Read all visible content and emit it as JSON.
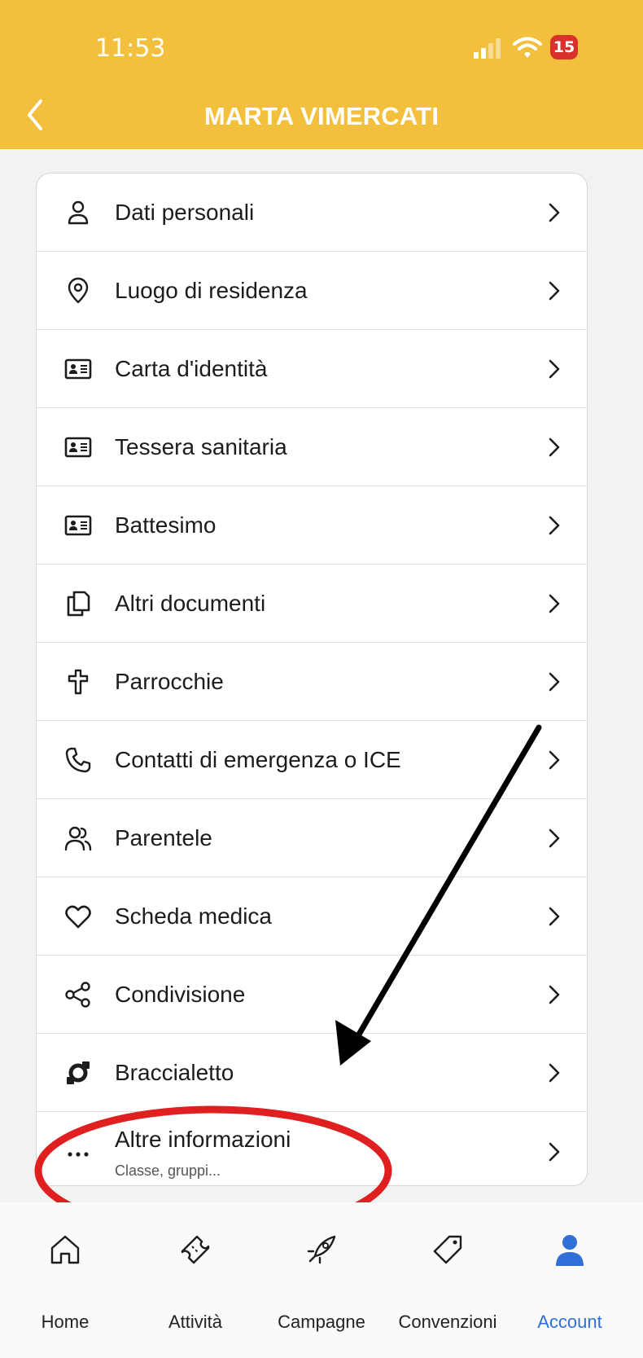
{
  "status_bar": {
    "time": "11:53",
    "battery": "15"
  },
  "header": {
    "title": "MARTA VIMERCATI"
  },
  "menu": {
    "items": [
      {
        "label": "Dati personali",
        "icon": "person-icon"
      },
      {
        "label": "Luogo di residenza",
        "icon": "location-pin-icon"
      },
      {
        "label": "Carta d'identità",
        "icon": "id-card-icon"
      },
      {
        "label": "Tessera sanitaria",
        "icon": "id-card-icon"
      },
      {
        "label": "Battesimo",
        "icon": "id-card-icon"
      },
      {
        "label": "Altri documenti",
        "icon": "documents-icon"
      },
      {
        "label": "Parrocchie",
        "icon": "cross-icon"
      },
      {
        "label": "Contatti di emergenza o ICE",
        "icon": "phone-icon"
      },
      {
        "label": "Parentele",
        "icon": "people-icon"
      },
      {
        "label": "Scheda medica",
        "icon": "heart-icon"
      },
      {
        "label": "Condivisione",
        "icon": "share-icon"
      },
      {
        "label": "Braccialetto",
        "icon": "bracelet-icon"
      },
      {
        "label": "Altre informazioni",
        "sublabel": "Classe, gruppi...",
        "icon": "more-icon"
      }
    ]
  },
  "bottom_nav": {
    "tabs": [
      {
        "label": "Home",
        "icon": "home-icon"
      },
      {
        "label": "Attività",
        "icon": "ticket-icon"
      },
      {
        "label": "Campagne",
        "icon": "rocket-icon"
      },
      {
        "label": "Convenzioni",
        "icon": "tag-icon"
      },
      {
        "label": "Account",
        "icon": "account-icon",
        "active": true
      }
    ]
  },
  "colors": {
    "header": "#f3c03d",
    "active_tab": "#2f6fd6",
    "annotation_red": "#e02020"
  }
}
